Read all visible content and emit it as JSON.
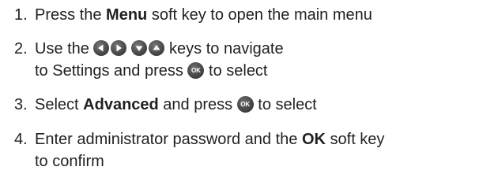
{
  "steps": [
    {
      "number": "1.",
      "parts": {
        "a": "Press the ",
        "b": "Menu",
        "c": " soft key to open the main menu"
      }
    },
    {
      "number": "2.",
      "parts": {
        "a": "Use the ",
        "c": " keys to navigate",
        "d": "to Settings and press ",
        "e": " to select"
      },
      "icons": [
        "left-arrow-key",
        "right-arrow-key",
        "down-arrow-key",
        "up-arrow-key",
        "ok-key"
      ]
    },
    {
      "number": "3.",
      "parts": {
        "a": "Select ",
        "b": "Advanced",
        "c": " and press ",
        "d": " to select"
      },
      "icons": [
        "ok-key"
      ]
    },
    {
      "number": "4.",
      "parts": {
        "a": "Enter administrator password and the ",
        "b": "OK",
        "c": " soft key",
        "d": "to confirm"
      }
    }
  ],
  "ok_key_label": "OK",
  "colors": {
    "text": "#231f20",
    "key": "#4a4a4a",
    "key_glyph": "#ffffff"
  }
}
